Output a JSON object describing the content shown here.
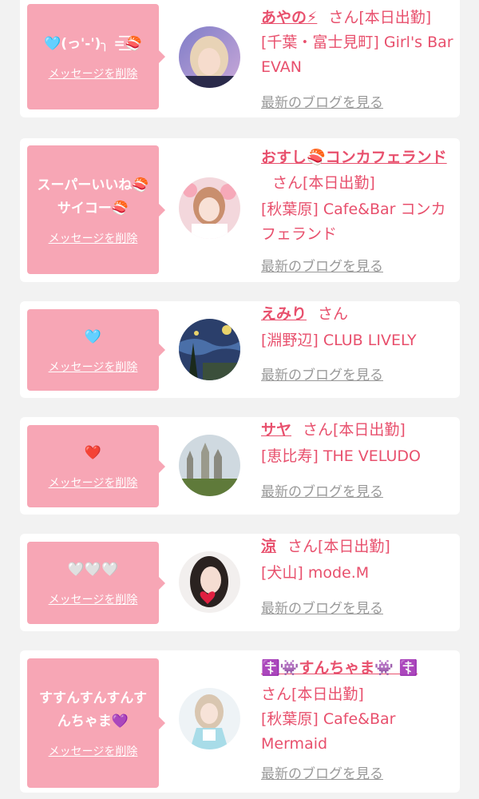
{
  "colors": {
    "accent": "#e8506d",
    "bubble": "#f7a6b5",
    "background": "#f2f2f2",
    "muted": "#999999"
  },
  "common": {
    "delete_label": "メッセージを削除",
    "blog_label": "最新のブログを見る"
  },
  "cards": [
    {
      "message": "🩵(っ'-')╮ =͟͟͞͞🍣",
      "name": "あやの⚡",
      "san": "さん[本日出勤]",
      "shop": "[千葉・富士見町] Girl's Bar EVAN",
      "avatar_icon": "avatar-photo-woman-blonde"
    },
    {
      "message": "スーパーいいね🍣サイコー🍣",
      "name": "おすし🍣コンカフェランド",
      "san": "さん[本日出勤]",
      "shop": "[秋葉原] Cafe&Bar コンカフェランド",
      "avatar_icon": "avatar-photo-woman-flowers"
    },
    {
      "message": "🩵",
      "name": "えみり",
      "san": "さん",
      "shop": "[淵野辺] CLUB LIVELY",
      "avatar_icon": "avatar-photo-starry-night"
    },
    {
      "message": "❤️",
      "name": "サヤ",
      "san": "さん[本日出勤]",
      "shop": "[恵比寿] THE VELUDO",
      "avatar_icon": "avatar-photo-castle"
    },
    {
      "message": "🤍🤍🤍",
      "name": "涼",
      "san": "さん[本日出勤]",
      "shop": "[犬山] mode.M",
      "avatar_icon": "avatar-photo-woman-heart"
    },
    {
      "message": "すすんすんすんすんちゃま💜",
      "name": "☦️👾すんちゃま👾 ☦️",
      "san": "さん[本日出勤]",
      "shop": "[秋葉原] Cafe&Bar Mermaid",
      "avatar_icon": "avatar-photo-woman-maid"
    }
  ]
}
